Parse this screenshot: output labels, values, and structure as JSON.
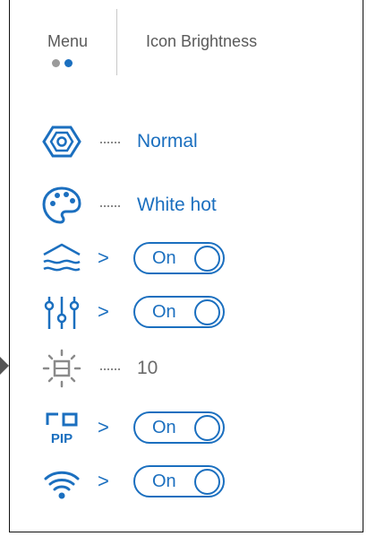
{
  "header": {
    "menu_label": "Menu",
    "title": "Icon Brightness",
    "page_dots": [
      "#9a9a9a",
      "#1b6fbf"
    ]
  },
  "colors": {
    "accent": "#1b6fbf",
    "grey": "#6b6b6b"
  },
  "rows": [
    {
      "icon": "hexagon-nut-icon",
      "type": "value",
      "value": "Normal"
    },
    {
      "icon": "palette-icon",
      "type": "value",
      "value": "White hot"
    },
    {
      "icon": "waves-icon",
      "type": "toggle",
      "toggle_label": "On"
    },
    {
      "icon": "sliders-icon",
      "type": "toggle",
      "toggle_label": "On"
    },
    {
      "icon": "brightness-icon",
      "type": "value",
      "value": "10",
      "selected": true
    },
    {
      "icon": "pip-icon",
      "type": "toggle",
      "toggle_label": "On",
      "icon_text": "PIP"
    },
    {
      "icon": "wifi-icon",
      "type": "toggle",
      "toggle_label": "On"
    }
  ]
}
